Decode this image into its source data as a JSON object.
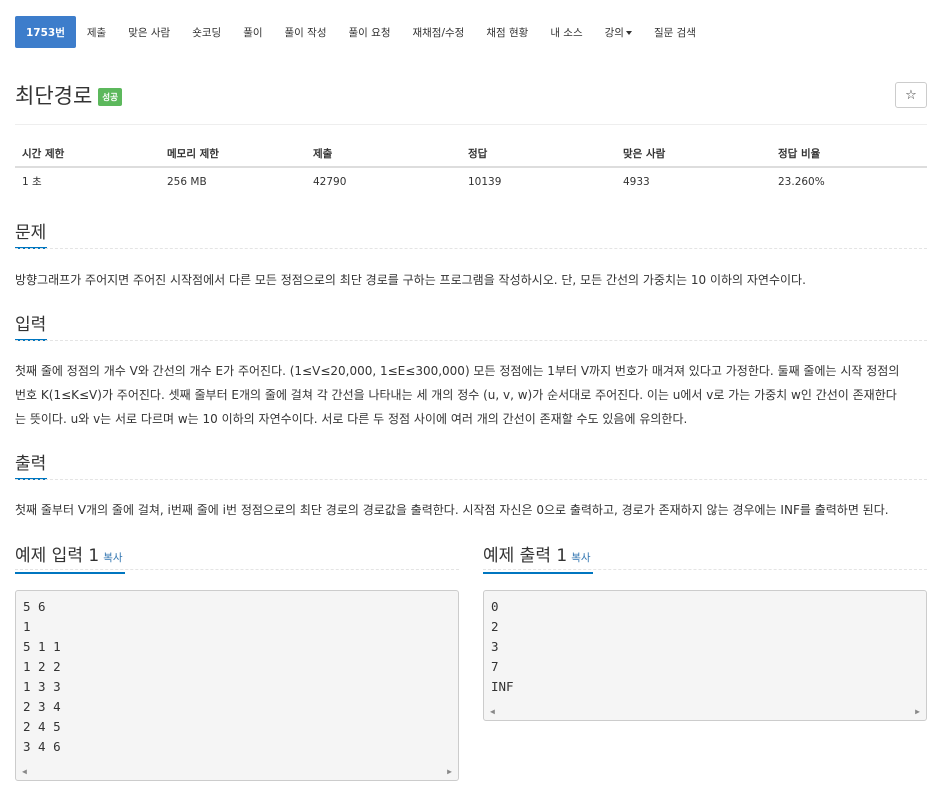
{
  "nav": {
    "items": [
      "1753번",
      "제출",
      "맞은 사람",
      "숏코딩",
      "풀이",
      "풀이 작성",
      "풀이 요청",
      "재채점/수정",
      "채점 현황",
      "내 소스",
      "강의",
      "질문 검색"
    ]
  },
  "problem": {
    "title": "최단경로",
    "badge": "성공",
    "star": "☆"
  },
  "info": {
    "headers": [
      "시간 제한",
      "메모리 제한",
      "제출",
      "정답",
      "맞은 사람",
      "정답 비율"
    ],
    "values": [
      "1 초",
      "256 MB",
      "42790",
      "10139",
      "4933",
      "23.260%"
    ]
  },
  "sections": {
    "problem_title": "문제",
    "problem_text": "방향그래프가 주어지면 주어진 시작점에서 다른 모든 정점으로의 최단 경로를 구하는 프로그램을 작성하시오. 단, 모든 간선의 가중치는 10 이하의 자연수이다.",
    "input_title": "입력",
    "input_lines": [
      "첫째 줄에 정점의 개수 V와 간선의 개수 E가 주어진다. (1≤V≤20,000, 1≤E≤300,000) 모든 정점에는 1부터 V까지 번호가 매겨져 있다고 가정한다. 둘째 줄에는 시작 정점의",
      "번호 K(1≤K≤V)가 주어진다. 셋째 줄부터 E개의 줄에 걸쳐 각 간선을 나타내는 세 개의 정수 (u, v, w)가 순서대로 주어진다. 이는 u에서 v로 가는 가중치 w인 간선이 존재한다",
      "는 뜻이다. u와 v는 서로 다르며 w는 10 이하의 자연수이다. 서로 다른 두 정점 사이에 여러 개의 간선이 존재할 수도 있음에 유의한다."
    ],
    "output_title": "출력",
    "output_text": "첫째 줄부터 V개의 줄에 걸쳐, i번째 줄에 i번 정점으로의 최단 경로의 경로값을 출력한다. 시작점 자신은 0으로 출력하고, 경로가 존재하지 않는 경우에는 INF를 출력하면 된다."
  },
  "samples": {
    "input_title": "예제 입력 1",
    "output_title": "예제 출력 1",
    "copy_label": "복사",
    "input_lines": [
      "5 6",
      "1",
      "5 1 1",
      "1 2 2",
      "1 3 3",
      "2 3 4",
      "2 4 5",
      "3 4 6"
    ],
    "output_lines": [
      "0",
      "2",
      "3",
      "7",
      "INF"
    ]
  },
  "colors": {
    "nav_active": "#3d7dcb",
    "badge_success": "#5cb85c",
    "section_underline": "#0076c0",
    "copy_link": "#3276b1"
  }
}
